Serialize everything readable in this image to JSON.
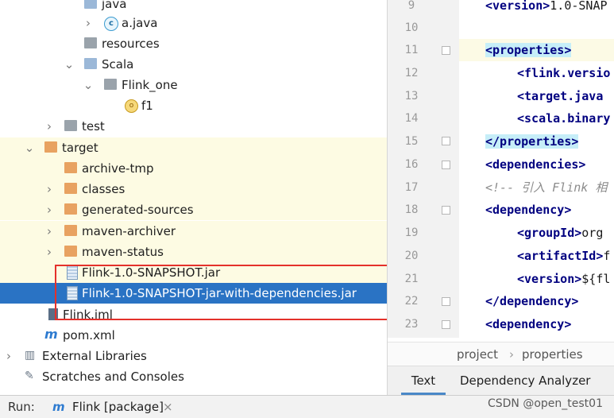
{
  "project_tree": {
    "items": [
      {
        "label": "java",
        "icon": "folder-blue-icon",
        "expanded": true
      },
      {
        "label": "a.java",
        "icon": "java-class-icon",
        "expanded": false
      },
      {
        "label": "resources",
        "icon": "folder-resources-icon"
      },
      {
        "label": "Scala",
        "icon": "folder-blue-icon",
        "expanded": true
      },
      {
        "label": "Flink_one",
        "icon": "package-icon",
        "expanded": true
      },
      {
        "label": "f1",
        "icon": "scala-object-icon"
      },
      {
        "label": "test",
        "icon": "folder-gray-icon",
        "expanded": false
      },
      {
        "label": "target",
        "icon": "folder-orange-icon",
        "expanded": true
      },
      {
        "label": "archive-tmp",
        "icon": "folder-orange-icon"
      },
      {
        "label": "classes",
        "icon": "folder-orange-icon",
        "expanded": false
      },
      {
        "label": "generated-sources",
        "icon": "folder-orange-icon",
        "expanded": false
      },
      {
        "label": "maven-archiver",
        "icon": "folder-orange-icon",
        "expanded": false
      },
      {
        "label": "maven-status",
        "icon": "folder-orange-icon",
        "expanded": false
      },
      {
        "label": "Flink-1.0-SNAPSHOT.jar",
        "icon": "jar-file-icon"
      },
      {
        "label": "Flink-1.0-SNAPSHOT-jar-with-dependencies.jar",
        "icon": "jar-file-icon",
        "selected": true
      },
      {
        "label": "Flink.iml",
        "icon": "iml-file-icon"
      },
      {
        "label": "pom.xml",
        "icon": "maven-pom-icon"
      },
      {
        "label": "External Libraries",
        "icon": "libraries-icon",
        "expanded": false
      },
      {
        "label": "Scratches and Consoles",
        "icon": "scratches-icon",
        "expanded": false
      }
    ]
  },
  "editor": {
    "line_numbers": [
      "9",
      "10",
      "11",
      "12",
      "13",
      "14",
      "15",
      "16",
      "17",
      "18",
      "19",
      "20",
      "21",
      "22",
      "23"
    ],
    "lines": [
      {
        "tag": "<version>",
        "rest": "1.0-SNAP"
      },
      {
        "tag": "",
        "rest": ""
      },
      {
        "tag": "<properties>",
        "rest": ""
      },
      {
        "tag": "<flink.versio",
        "rest": ""
      },
      {
        "tag": "<target.java",
        "rest": ""
      },
      {
        "tag": "<scala.binary",
        "rest": ""
      },
      {
        "tag": "</properties>",
        "rest": ""
      },
      {
        "tag": "<dependencies>",
        "rest": ""
      },
      {
        "tag": "",
        "rest": "<!-- 引入 Flink 相"
      },
      {
        "tag": "<dependency>",
        "rest": ""
      },
      {
        "tag": "<groupId>",
        "rest": "org"
      },
      {
        "tag": "<artifactId>",
        "rest": "f"
      },
      {
        "tag": "<version>",
        "rest": "${fl"
      },
      {
        "tag": "</dependency>",
        "rest": ""
      },
      {
        "tag": "<dependency>",
        "rest": ""
      }
    ],
    "breadcrumb": {
      "first": "project",
      "separator": "›",
      "second": "properties"
    },
    "tabs": {
      "text": "Text",
      "dependency": "Dependency Analyzer"
    }
  },
  "run_bar": {
    "label": "Run:",
    "config": "Flink [package]",
    "close": "×"
  },
  "watermark": "CSDN @open_test01",
  "colors": {
    "selection": "#2a73c4",
    "highlight_box": "#e4312b",
    "xml_tag": "#000080"
  }
}
